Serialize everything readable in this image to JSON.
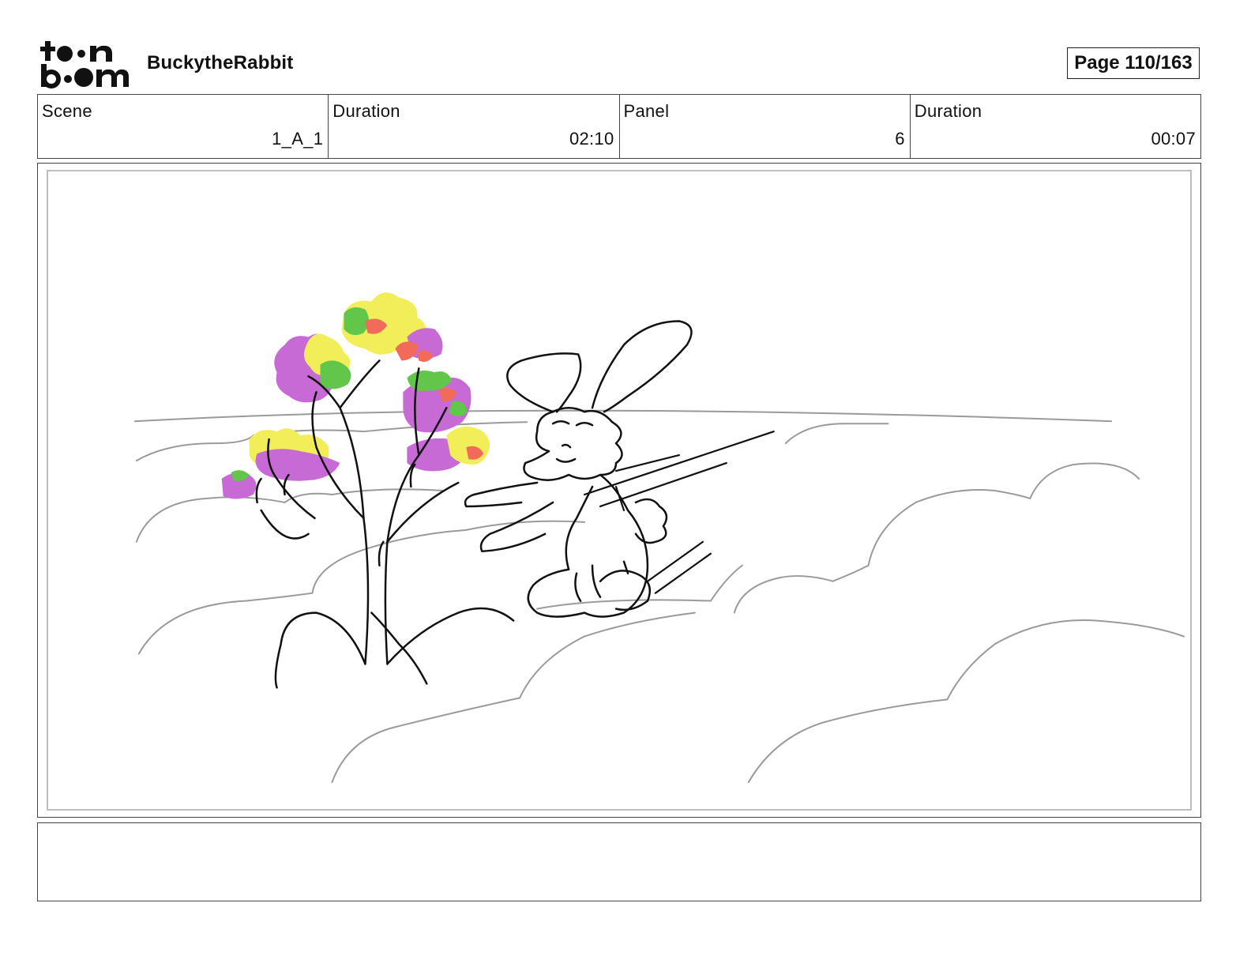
{
  "header": {
    "logo_alt": "toon boom",
    "project_name": "BuckytheRabbit",
    "page_label": "Page 110/163"
  },
  "info": {
    "scene_label": "Scene",
    "scene_value": "1_A_1",
    "scene_duration_label": "Duration",
    "scene_duration_value": "02:10",
    "panel_label": "Panel",
    "panel_value": "6",
    "panel_duration_label": "Duration",
    "panel_duration_value": "00:07"
  },
  "caption": {
    "text": ""
  },
  "colors": {
    "foliage_magenta": "#c86ad6",
    "foliage_yellow": "#f2ee5a",
    "foliage_green": "#62c64a",
    "foliage_red": "#f26a5a",
    "cloud_lines": "#9a9a9a",
    "ink": "#111111"
  }
}
